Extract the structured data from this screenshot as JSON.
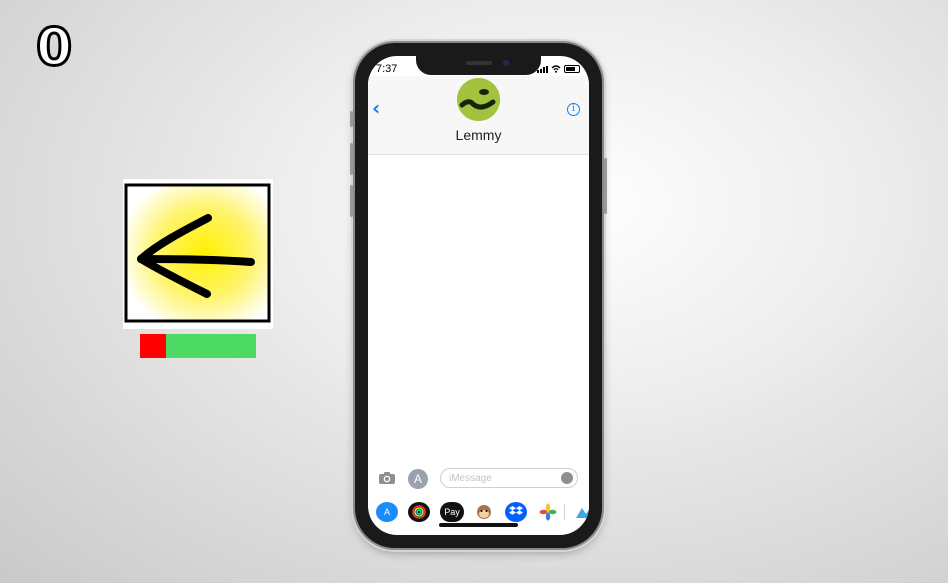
{
  "game": {
    "score": "0",
    "timer_remaining_fraction": 0.78
  },
  "back_card": {
    "icon": "left-arrow-icon",
    "colors": {
      "glow": "#ffe600",
      "stroke": "#000000"
    }
  },
  "timer_colors": {
    "used": "#ff0000",
    "remaining": "#4cd964"
  },
  "phone": {
    "status_bar": {
      "time": "7:37"
    },
    "conversation": {
      "contact_name": "Lemmy",
      "back_icon": "chevron-left-icon",
      "info_icon": "info-icon",
      "info_label": "i"
    },
    "composer": {
      "placeholder": "iMessage",
      "camera_icon": "camera-icon",
      "apps_icon": "app-store-icon",
      "mic_icon": "microphone-icon"
    },
    "app_drawer": {
      "apps": [
        {
          "name": "App Store",
          "icon": "app-store-icon",
          "color": "#1a8cff"
        },
        {
          "name": "Activity",
          "icon": "activity-rings-icon",
          "color": "#111111"
        },
        {
          "name": "Apple Pay",
          "icon": "apple-pay-icon",
          "label": "Pay",
          "color": "#111111"
        },
        {
          "name": "Animoji",
          "icon": "monkey-icon",
          "color": "#ffffff"
        },
        {
          "name": "Dropbox",
          "icon": "dropbox-icon",
          "color": "#0061fe"
        },
        {
          "name": "Photos",
          "icon": "photos-icon",
          "color": "#ffffff"
        },
        {
          "name": "More",
          "icon": "mountain-icon",
          "color": "#ffffff"
        }
      ]
    },
    "accent": "#147efb"
  }
}
